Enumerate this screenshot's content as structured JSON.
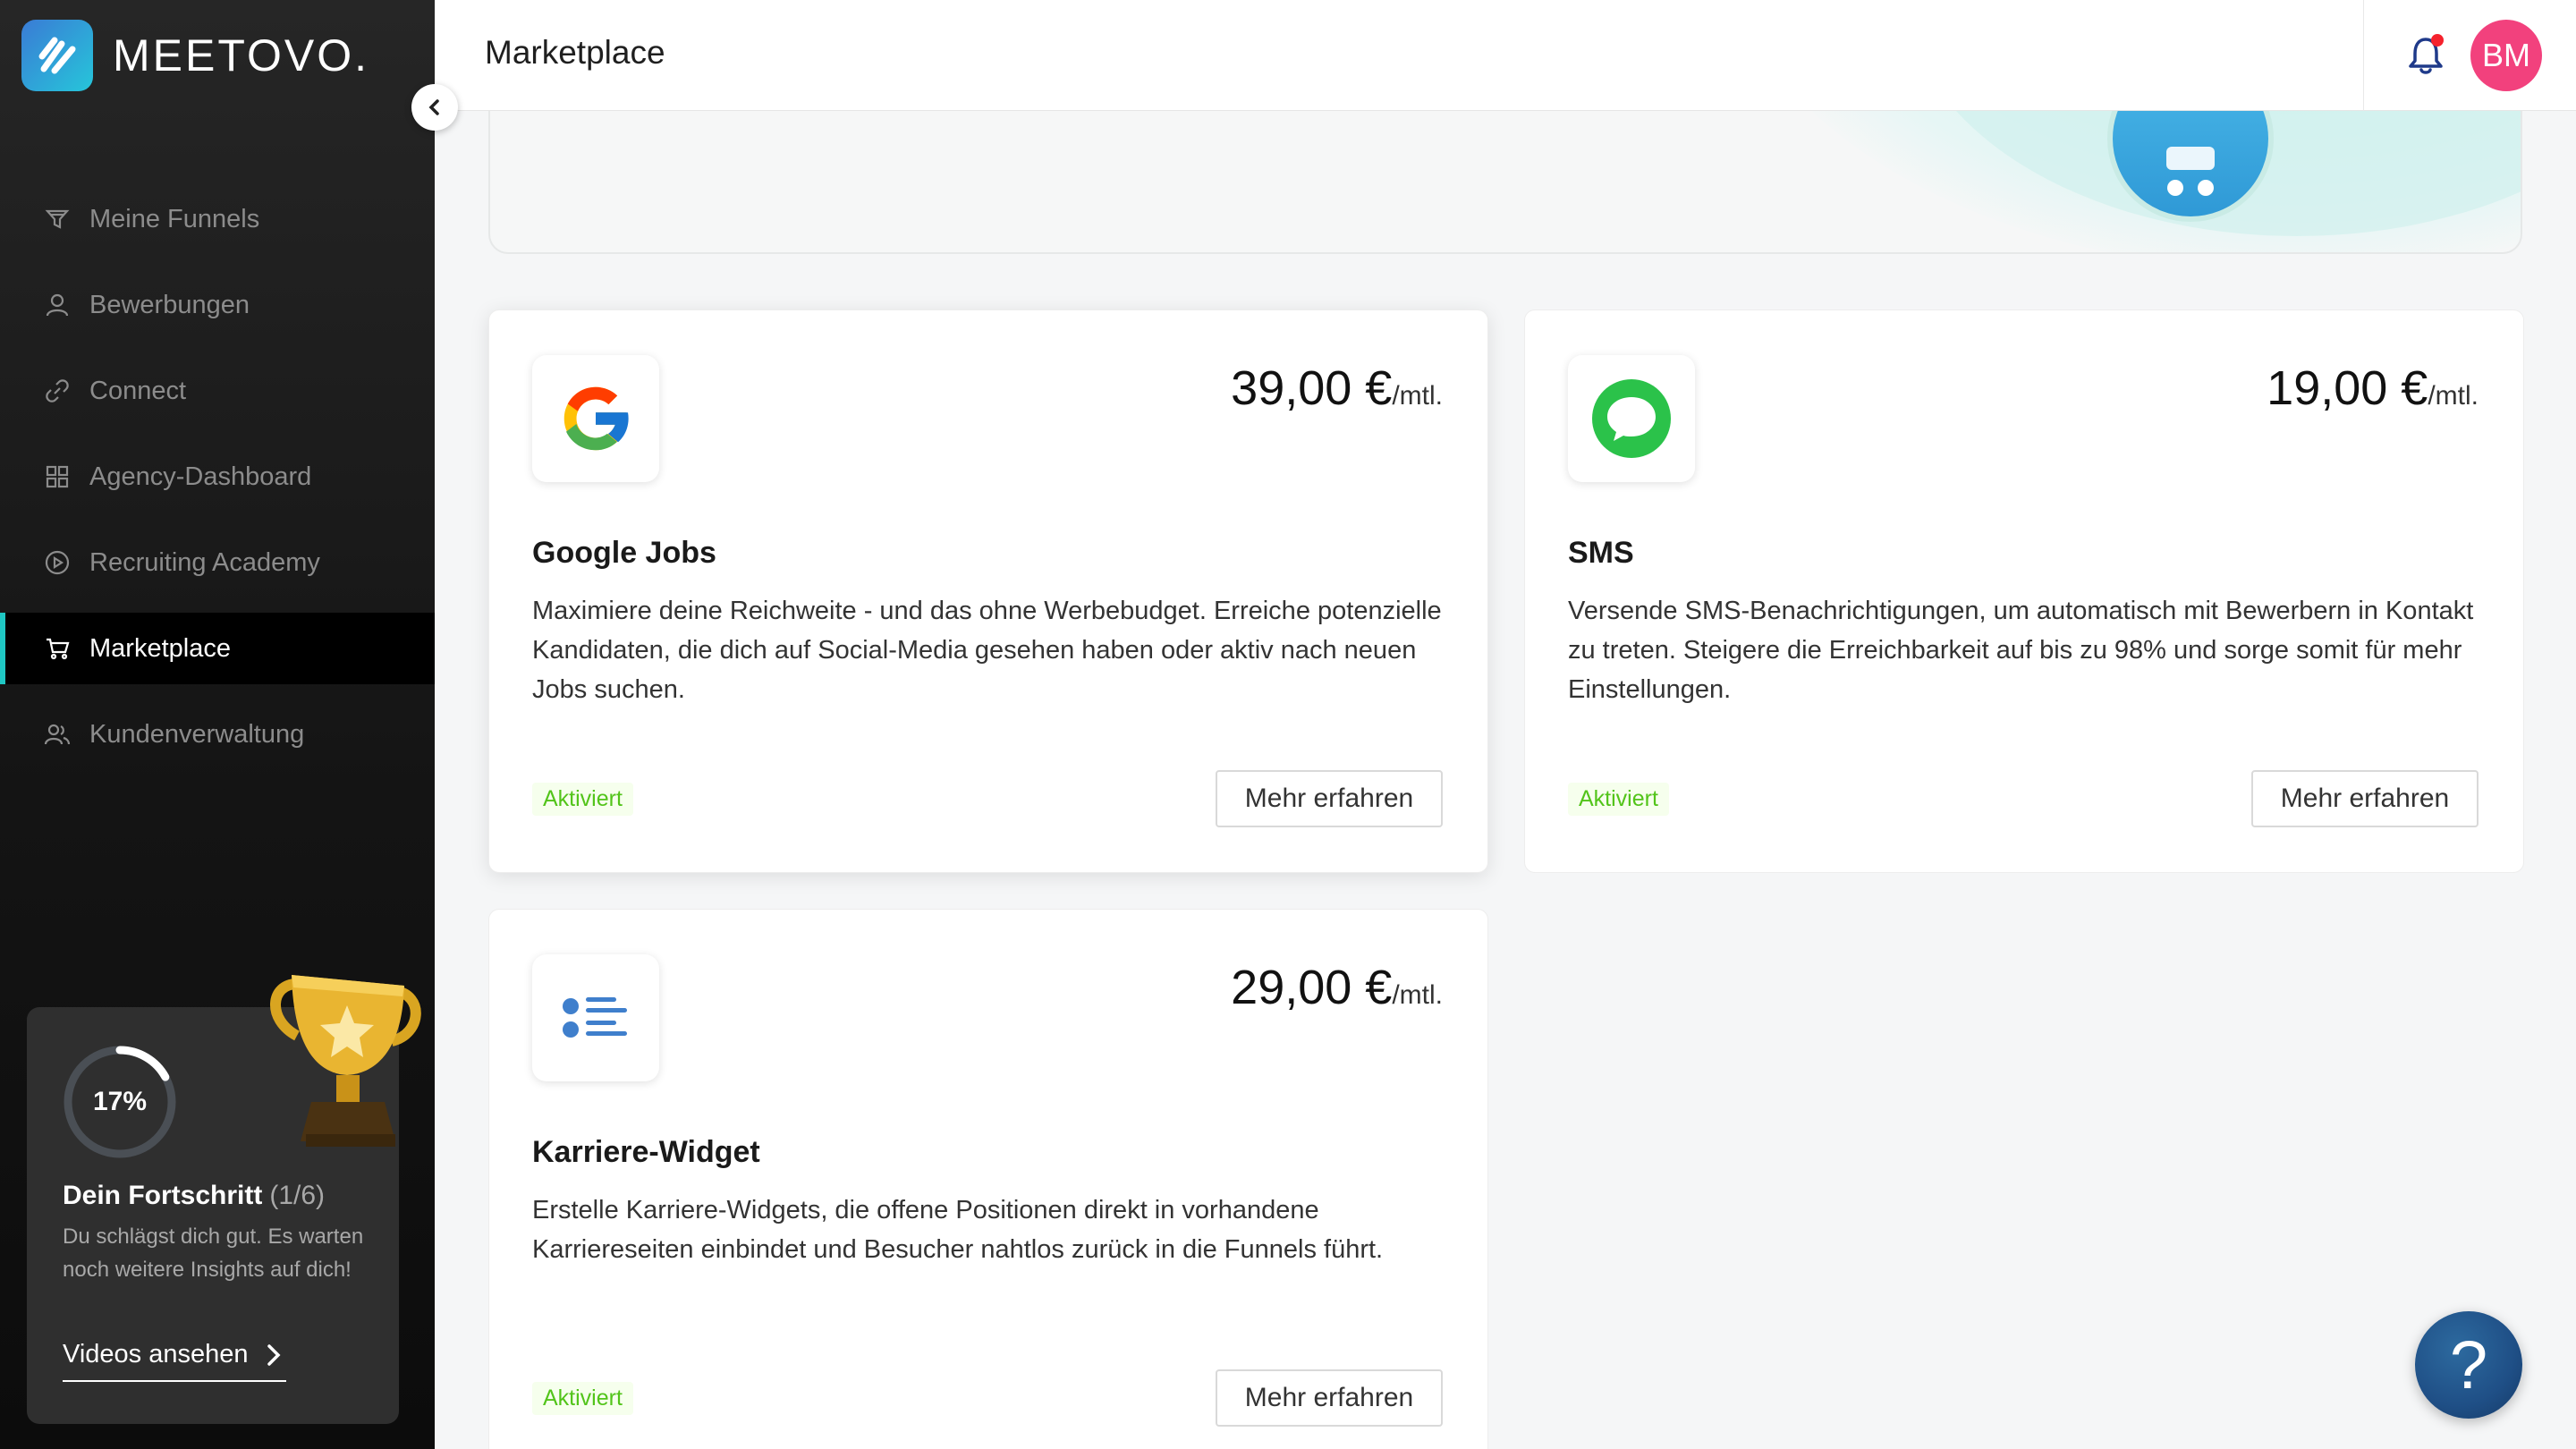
{
  "brand": {
    "name": "MEETOVO.",
    "accent": "#1fc7c3"
  },
  "sidebar": {
    "items": [
      {
        "label": "Meine Funnels",
        "icon": "funnel-icon",
        "active": false
      },
      {
        "label": "Bewerbungen",
        "icon": "user-icon",
        "active": false
      },
      {
        "label": "Connect",
        "icon": "link-icon",
        "active": false
      },
      {
        "label": "Agency-Dashboard",
        "icon": "grid-icon",
        "active": false
      },
      {
        "label": "Recruiting Academy",
        "icon": "play-circle-icon",
        "active": false
      },
      {
        "label": "Marketplace",
        "icon": "cart-icon",
        "active": true
      },
      {
        "label": "Kundenverwaltung",
        "icon": "users-icon",
        "active": false
      }
    ],
    "progress": {
      "percent_label": "17%",
      "percent_value": 17,
      "title": "Dein Fortschritt",
      "steps": "(1/6)",
      "description": "Du schlägst dich gut. Es warten noch weitere Insights auf dich!",
      "link_label": "Videos ansehen"
    }
  },
  "header": {
    "title": "Marketplace",
    "avatar_initials": "BM",
    "avatar_color": "#f2417d"
  },
  "cards": [
    {
      "title": "Google Jobs",
      "price": "39,00 €",
      "unit": "/mtl.",
      "description": "Maximiere deine Reichweite - und das ohne Werbebudget. Erreiche potenzielle Kandidaten, die dich auf Social-Media gesehen haben oder aktiv nach neuen Jobs suchen.",
      "status": "Aktiviert",
      "button": "Mehr erfahren",
      "icon": "google-icon"
    },
    {
      "title": "SMS",
      "price": "19,00 €",
      "unit": "/mtl.",
      "description": "Versende SMS-Benachrichtigungen, um automatisch mit Bewerbern in Kontakt zu treten. Steigere die Erreichbarkeit auf bis zu 98% und sorge somit für mehr Einstellungen.",
      "status": "Aktiviert",
      "button": "Mehr erfahren",
      "icon": "message-bubble-icon"
    },
    {
      "title": "Karriere-Widget",
      "price": "29,00 €",
      "unit": "/mtl.",
      "description": "Erstelle Karriere-Widgets, die offene Positionen direkt in vorhandene Karriereseiten einbindet und Besucher nahtlos zurück in die Funnels führt.",
      "status": "Aktiviert",
      "button": "Mehr erfahren",
      "icon": "list-icon"
    }
  ],
  "help": {
    "label": "?"
  }
}
